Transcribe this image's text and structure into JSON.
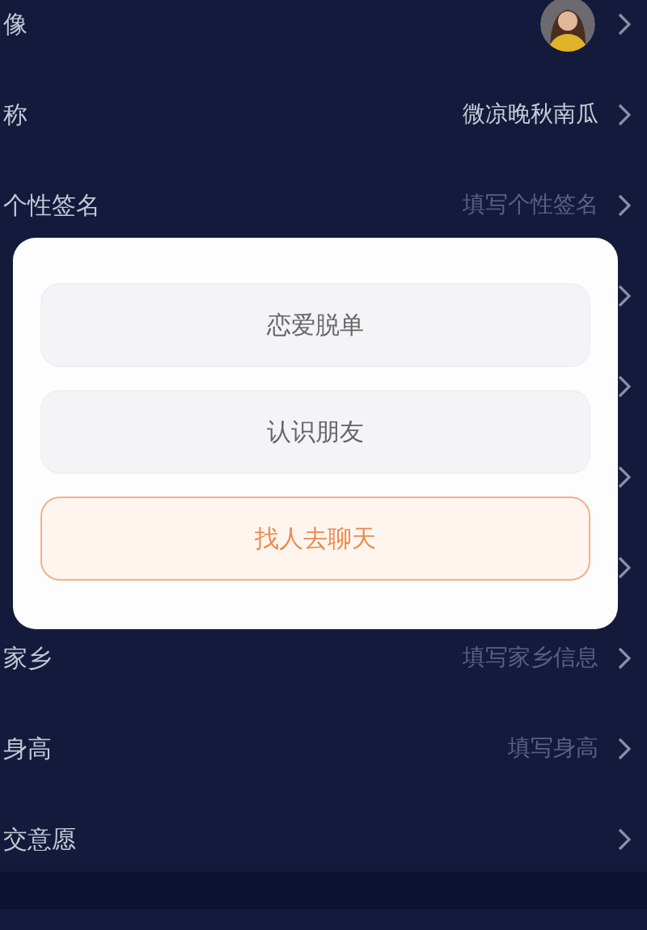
{
  "rows": [
    {
      "kind": "avatar",
      "label": "像"
    },
    {
      "kind": "text",
      "label": "称",
      "value": "微凉晚秋南瓜"
    },
    {
      "kind": "hint",
      "label": "个性签名",
      "value": "填写个性签名"
    },
    {
      "kind": "covered"
    },
    {
      "kind": "covered"
    },
    {
      "kind": "covered"
    },
    {
      "kind": "covered"
    },
    {
      "kind": "hint",
      "label": "家乡",
      "value": "填写家乡信息"
    },
    {
      "kind": "hint",
      "label": "身高",
      "value": "填写身高"
    },
    {
      "kind": "text",
      "label": "交意愿"
    }
  ],
  "dialog": {
    "options": [
      {
        "label": "恋爱脱单",
        "selected": false
      },
      {
        "label": "认识朋友",
        "selected": false
      },
      {
        "label": "找人去聊天",
        "selected": true
      }
    ]
  }
}
